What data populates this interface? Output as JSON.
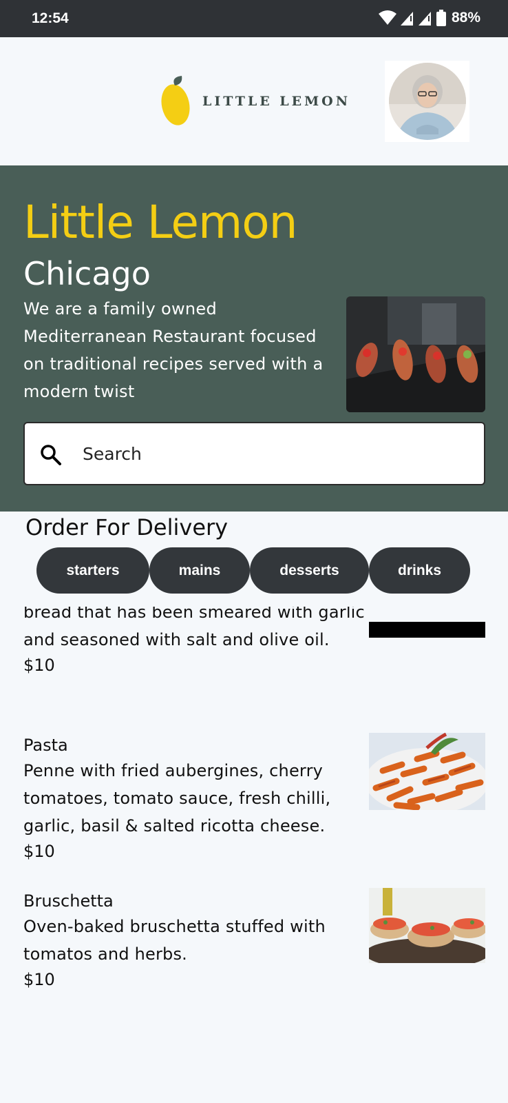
{
  "status_bar": {
    "time": "12:54",
    "battery": "88%"
  },
  "header": {
    "logo_text": "LITTLE LEMON"
  },
  "hero": {
    "title": "Little Lemon",
    "city": "Chicago",
    "description": "We are a family owned Mediterranean Restaurant focused on traditional recipes served with a modern twist"
  },
  "search": {
    "placeholder": "Search"
  },
  "order": {
    "title": "Order For Delivery",
    "categories": [
      "starters",
      "mains",
      "desserts",
      "drinks"
    ]
  },
  "menu_items": [
    {
      "name": "",
      "description": "bread that has been smeared with garlic and seasoned with salt and olive oil.",
      "price": "$10"
    },
    {
      "name": "Pasta",
      "description": "Penne with fried aubergines, cherry tomatoes, tomato sauce, fresh chilli, garlic, basil & salted ricotta cheese.",
      "price": "$10"
    },
    {
      "name": "Bruschetta",
      "description": "Oven-baked bruschetta stuffed with tomatos and herbs.",
      "price": "$10"
    }
  ],
  "colors": {
    "primary_green": "#495e57",
    "primary_yellow": "#f4ce14",
    "chip_bg": "#33373b"
  }
}
